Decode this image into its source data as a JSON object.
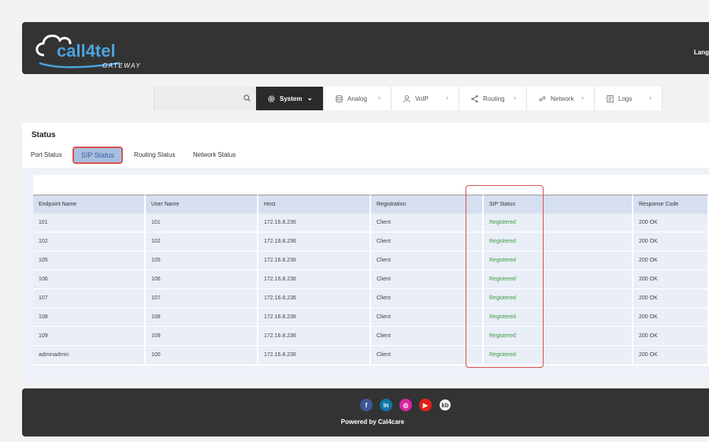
{
  "header": {
    "logo_text": "call4tel",
    "logo_sub": "GATEWAY",
    "language_label": "Lang"
  },
  "nav": {
    "items": [
      {
        "label": "System",
        "icon": "gear-icon"
      },
      {
        "label": "Analog",
        "icon": "database-icon"
      },
      {
        "label": "VoIP",
        "icon": "user-icon"
      },
      {
        "label": "Routing",
        "icon": "share-icon"
      },
      {
        "label": "Network",
        "icon": "link-icon"
      },
      {
        "label": "Logs",
        "icon": "document-icon"
      }
    ]
  },
  "status": {
    "title": "Status",
    "tabs": [
      "Port Status",
      "SIP Status",
      "Routing Status",
      "Network Status"
    ]
  },
  "table": {
    "headers": [
      "Endpoint Name",
      "User Name",
      "Host",
      "Registration",
      "SIP Status",
      "Response Code"
    ],
    "rows": [
      [
        "101",
        "101",
        "172.16.8.236",
        "Client",
        "Registered",
        "200 OK"
      ],
      [
        "102",
        "102",
        "172.16.8.236",
        "Client",
        "Registered",
        "200 OK"
      ],
      [
        "105",
        "105",
        "172.16.8.236",
        "Client",
        "Registered",
        "200 OK"
      ],
      [
        "106",
        "106",
        "172.16.8.236",
        "Client",
        "Registered",
        "200 OK"
      ],
      [
        "107",
        "107",
        "172.16.8.236",
        "Client",
        "Registered",
        "200 OK"
      ],
      [
        "108",
        "108",
        "172.16.8.236",
        "Client",
        "Registered",
        "200 OK"
      ],
      [
        "109",
        "109",
        "172.16.8.236",
        "Client",
        "Registered",
        "200 OK"
      ],
      [
        "adminadmin",
        "100",
        "172.16.8.236",
        "Client",
        "Registered",
        "200 OK"
      ]
    ]
  },
  "footer": {
    "powered_by": "Powered by Cal4care",
    "social": [
      "facebook-icon",
      "linkedin-icon",
      "instagram-icon",
      "youtube-icon",
      "kb-icon"
    ],
    "kb_label": "kb"
  }
}
